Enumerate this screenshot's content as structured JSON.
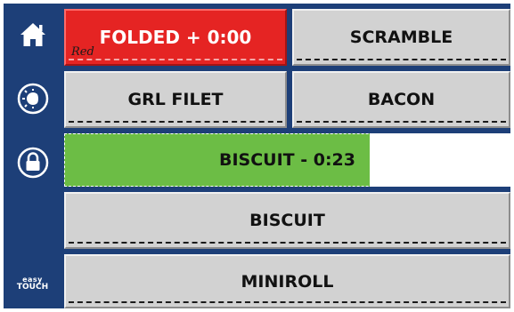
{
  "sidebar": {
    "home": "home-icon",
    "day_night": "day-night-icon",
    "lock": "lock-icon",
    "brand_line1": "easy",
    "brand_line2": "TOUCH"
  },
  "tiles": {
    "folded": {
      "label": "FOLDED + 0:00",
      "sub": "Red",
      "color": "#e52423"
    },
    "scramble": {
      "label": "SCRAMBLE"
    },
    "grl_filet": {
      "label": "GRL FILET"
    },
    "bacon": {
      "label": "BACON"
    },
    "biscuit_timer": {
      "label": "BISCUIT - 0:23",
      "progress": 0.685,
      "color": "#6cbd45"
    },
    "biscuit": {
      "label": "BISCUIT"
    },
    "miniroll": {
      "label": "MINIROLL"
    }
  },
  "colors": {
    "sidebar": "#1d3f78",
    "tile": "#d2d2d2"
  }
}
